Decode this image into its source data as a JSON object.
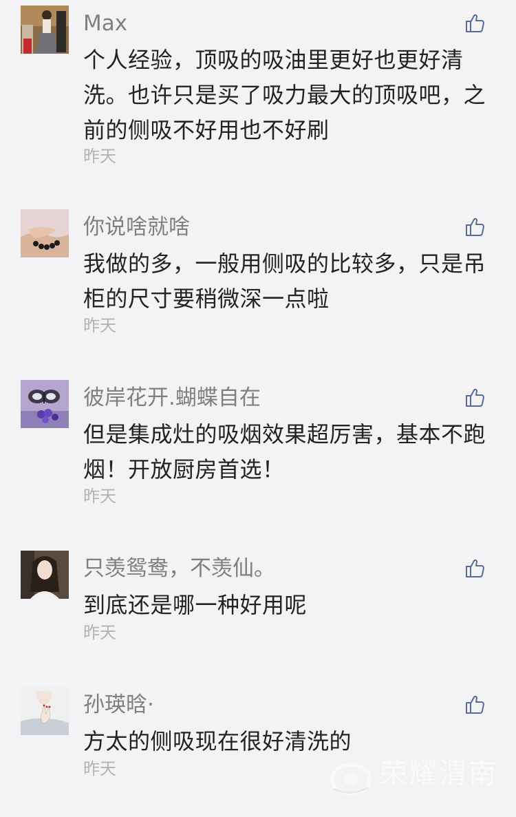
{
  "comments": [
    {
      "name": "Max",
      "text": "个人经验，顶吸的吸油里更好也更好清洗。也许只是买了吸力最大的顶吸吧，之前的侧吸不好用也不好刷",
      "time": "昨天",
      "avatar_icon": "avatar-woman-photo",
      "like_icon": "thumbs-up-icon"
    },
    {
      "name": "你说啥就啥",
      "text": "我做的多，一般用侧吸的比较多，只是吊柜的尺寸要稍微深一点啦",
      "time": "昨天",
      "avatar_icon": "avatar-hands-bracelet-photo",
      "like_icon": "thumbs-up-icon"
    },
    {
      "name": "彼岸花开.蝴蝶自在",
      "text": "但是集成灶的吸烟效果超厉害，基本不跑烟！开放厨房首选！",
      "time": "昨天",
      "avatar_icon": "avatar-butterfly-flower-photo",
      "like_icon": "thumbs-up-icon"
    },
    {
      "name": "只羡鸳鸯，不羡仙。",
      "text": "到底还是哪一种好用呢",
      "time": "昨天",
      "avatar_icon": "avatar-girl-portrait-photo",
      "like_icon": "thumbs-up-icon"
    },
    {
      "name": "孙瑛晗·",
      "text": "方太的侧吸现在很好清洗的",
      "time": "昨天",
      "avatar_icon": "avatar-illustrated-hand-photo",
      "like_icon": "thumbs-up-icon"
    }
  ],
  "watermark": {
    "title": "荣耀渭南",
    "url": "YEWN.CN"
  },
  "colors": {
    "background": "#f3f3f5",
    "name": "#7f7f80",
    "text": "#222222",
    "time": "#b3b3b3",
    "like": "#576b95"
  }
}
